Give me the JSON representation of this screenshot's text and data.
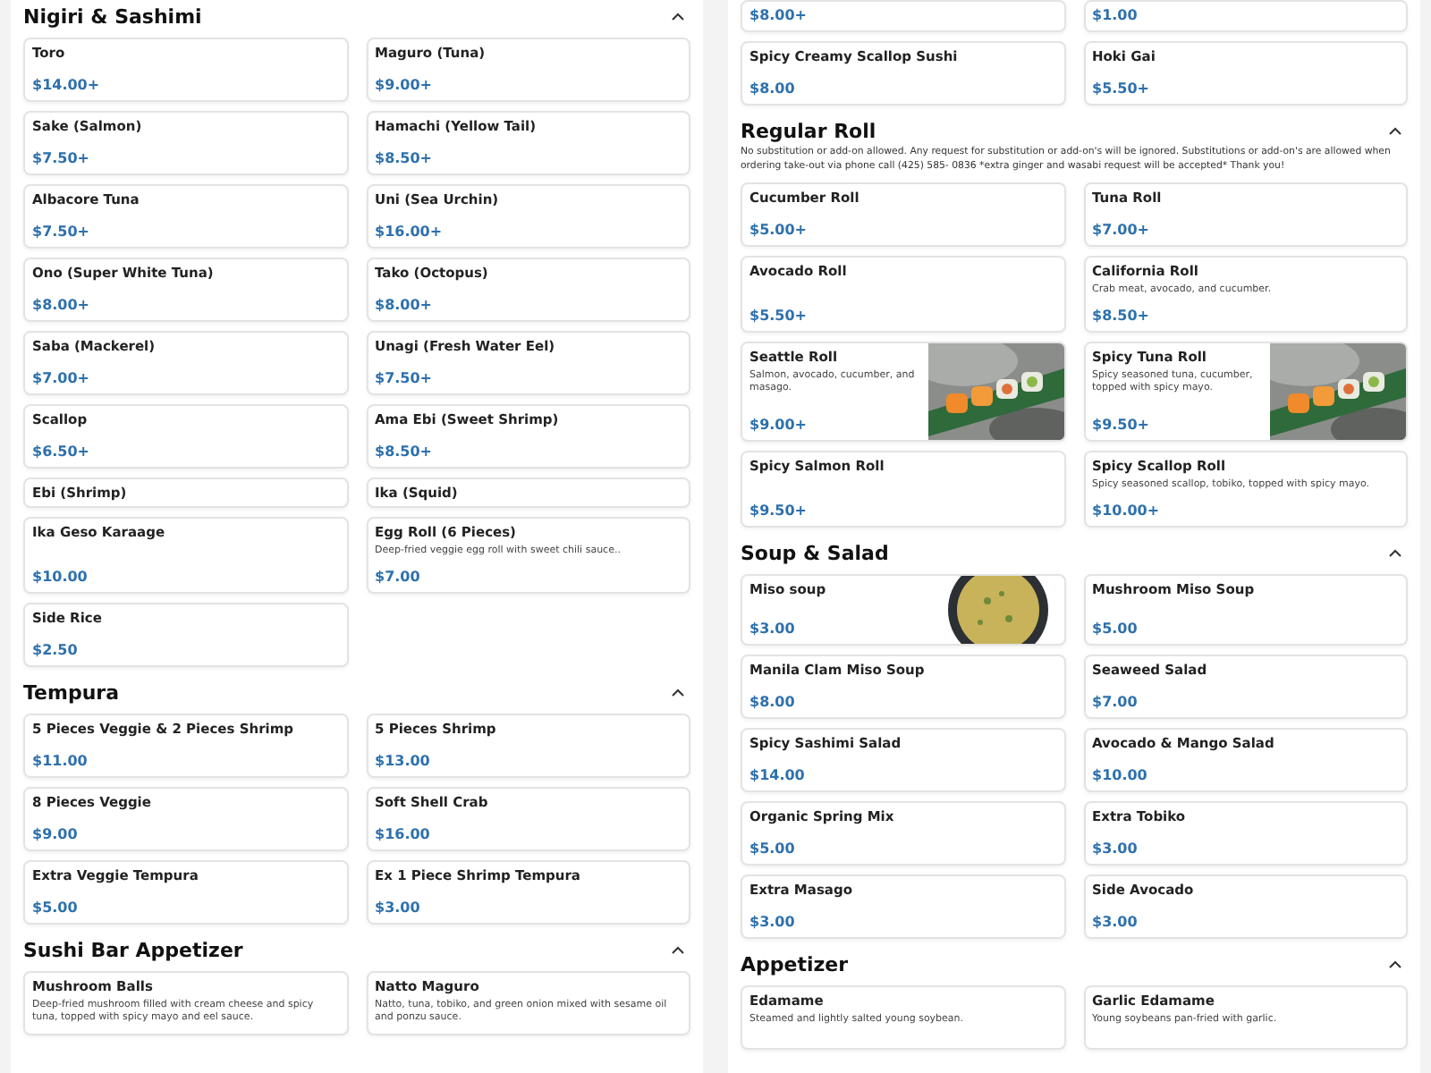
{
  "columns": [
    {
      "sections": [
        {
          "title": "Nigiri & Sashimi",
          "expanded": true,
          "items": [
            {
              "kind": "full",
              "name": "Toro",
              "price": "$14.00+"
            },
            {
              "kind": "full",
              "name": "Maguro (Tuna)",
              "price": "$9.00+"
            },
            {
              "kind": "full",
              "name": "Sake (Salmon)",
              "price": "$7.50+"
            },
            {
              "kind": "full",
              "name": "Hamachi (Yellow Tail)",
              "price": "$8.50+"
            },
            {
              "kind": "full",
              "name": "Albacore Tuna",
              "price": "$7.50+"
            },
            {
              "kind": "full",
              "name": "Uni (Sea Urchin)",
              "price": "$16.00+"
            },
            {
              "kind": "full",
              "name": "Ono (Super White Tuna)",
              "price": "$8.00+"
            },
            {
              "kind": "full",
              "name": "Tako (Octopus)",
              "price": "$8.00+"
            },
            {
              "kind": "full",
              "name": "Saba (Mackerel)",
              "price": "$7.00+"
            },
            {
              "kind": "full",
              "name": "Unagi (Fresh Water Eel)",
              "price": "$7.50+"
            },
            {
              "kind": "full",
              "name": "Scallop",
              "price": "$6.50+"
            },
            {
              "kind": "full",
              "name": "Ama Ebi (Sweet Shrimp)",
              "price": "$8.50+"
            },
            {
              "kind": "title-only",
              "name": "Ebi (Shrimp)"
            },
            {
              "kind": "title-only",
              "name": "Ika (Squid)"
            },
            {
              "kind": "full",
              "name": "Ika Geso Karaage",
              "price": "$10.00"
            },
            {
              "kind": "full",
              "name": "Egg Roll (6 Pieces)",
              "description": "Deep-fried veggie egg roll with sweet chili sauce..",
              "price": "$7.00"
            },
            {
              "kind": "full",
              "name": "Side Rice",
              "price": "$2.50"
            }
          ]
        },
        {
          "title": "Tempura",
          "expanded": true,
          "items": [
            {
              "kind": "full",
              "name": "5 Pieces Veggie & 2 Pieces Shrimp",
              "price": "$11.00"
            },
            {
              "kind": "full",
              "name": "5 Pieces Shrimp",
              "price": "$13.00"
            },
            {
              "kind": "full",
              "name": "8 Pieces Veggie",
              "price": "$9.00"
            },
            {
              "kind": "full",
              "name": "Soft Shell Crab",
              "price": "$16.00"
            },
            {
              "kind": "full",
              "name": "Extra Veggie Tempura",
              "price": "$5.00"
            },
            {
              "kind": "full",
              "name": "Ex 1 Piece Shrimp Tempura",
              "price": "$3.00"
            }
          ]
        },
        {
          "title": "Sushi Bar Appetizer",
          "expanded": true,
          "items": [
            {
              "kind": "full",
              "name": "Mushroom Balls",
              "description": "Deep-fried mushroom filled with cream cheese and spicy tuna, topped with spicy mayo and eel sauce."
            },
            {
              "kind": "full",
              "name": "Natto Maguro",
              "description": "Natto, tuna, tobiko, and green onion mixed with sesame oil and ponzu sauce."
            }
          ]
        }
      ]
    },
    {
      "sections": [
        {
          "items": [
            {
              "kind": "price-only",
              "price": "$8.00+"
            },
            {
              "kind": "price-only",
              "price": "$1.00"
            },
            {
              "kind": "full",
              "name": "Spicy Creamy Scallop Sushi",
              "price": "$8.00"
            },
            {
              "kind": "full",
              "name": "Hoki Gai",
              "price": "$5.50+"
            }
          ]
        },
        {
          "title": "Regular Roll",
          "expanded": true,
          "note": "No substitution or add-on allowed. Any request for substitution or add-on's will be ignored. Substitutions or add-on's are allowed when ordering take-out via phone call (425) 585- 0836 *extra ginger and wasabi request will be accepted* Thank you!",
          "items": [
            {
              "kind": "full",
              "name": "Cucumber Roll",
              "price": "$5.00+"
            },
            {
              "kind": "full",
              "name": "Tuna Roll",
              "price": "$7.00+"
            },
            {
              "kind": "full",
              "name": "Avocado Roll",
              "price": "$5.50+"
            },
            {
              "kind": "full",
              "name": "California Roll",
              "description": "Crab meat, avocado, and cucumber.",
              "price": "$8.50+"
            },
            {
              "kind": "full",
              "name": "Seattle Roll",
              "description": "Salmon, avocado, cucumber, and masago.",
              "price": "$9.00+"
            },
            {
              "kind": "full",
              "name": "Spicy Tuna Roll",
              "description": "Spicy seasoned tuna, cucumber, topped with spicy mayo.",
              "price": "$9.50+"
            },
            {
              "kind": "full",
              "name": "Spicy Salmon Roll",
              "price": "$9.50+"
            },
            {
              "kind": "full",
              "name": "Spicy Scallop Roll",
              "description": "Spicy seasoned scallop, tobiko, topped with spicy mayo.",
              "price": "$10.00+"
            }
          ]
        },
        {
          "title": "Soup & Salad",
          "expanded": true,
          "items": [
            {
              "kind": "full",
              "name": "Miso soup",
              "price": "$3.00"
            },
            {
              "kind": "full",
              "name": "Mushroom Miso Soup",
              "price": "$5.00"
            },
            {
              "kind": "full",
              "name": "Manila Clam Miso Soup",
              "price": "$8.00"
            },
            {
              "kind": "full",
              "name": "Seaweed Salad",
              "price": "$7.00"
            },
            {
              "kind": "full",
              "name": "Spicy Sashimi Salad",
              "price": "$14.00"
            },
            {
              "kind": "full",
              "name": "Avocado & Mango Salad",
              "price": "$10.00"
            },
            {
              "kind": "full",
              "name": "Organic Spring Mix",
              "price": "$5.00"
            },
            {
              "kind": "full",
              "name": "Extra Tobiko",
              "price": "$3.00"
            },
            {
              "kind": "full",
              "name": "Extra Masago",
              "price": "$3.00"
            },
            {
              "kind": "full",
              "name": "Side Avocado",
              "price": "$3.00"
            }
          ]
        },
        {
          "title": "Appetizer",
          "expanded": true,
          "items": [
            {
              "kind": "full",
              "name": "Edamame",
              "description": "Steamed and lightly salted young soybean."
            },
            {
              "kind": "full",
              "name": "Garlic Edamame",
              "description": "Young soybeans pan-fried with garlic."
            }
          ]
        }
      ]
    }
  ]
}
